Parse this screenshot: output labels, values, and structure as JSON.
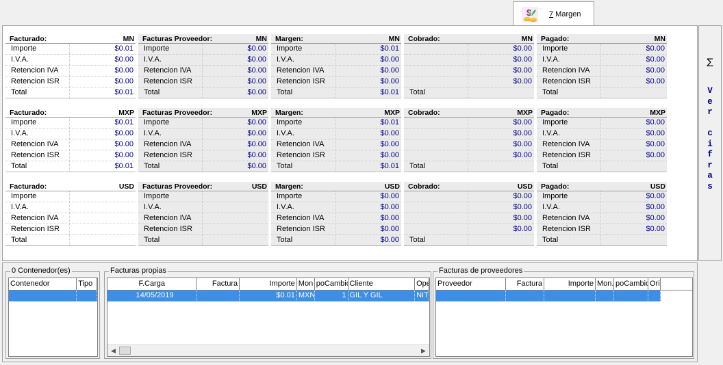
{
  "tab": {
    "label_key": "7",
    "label_rest": " Margen",
    "icon": "money-plant-icon"
  },
  "side": {
    "sigma": "Σ",
    "ver_cifras": "Ver\ncifras"
  },
  "accent": "#00008b",
  "summary": {
    "rows_labels": [
      "Importe",
      "I.V.A.",
      "Retencion IVA",
      "Retencion ISR",
      "Total"
    ],
    "sections": [
      {
        "currency": "MN",
        "cards": [
          {
            "title": "Facturado:",
            "values": [
              "$0.01",
              "$0.00",
              "$0.00",
              "$0.00",
              "$0.01"
            ]
          },
          {
            "title": "Facturas Proveedor:",
            "values": [
              "$0.00",
              "$0.00",
              "$0.00",
              "$0.00",
              "$0.00"
            ]
          },
          {
            "title": "Margen:",
            "values": [
              "$0.01",
              "$0.00",
              "$0.00",
              "$0.00",
              "$0.01"
            ]
          },
          {
            "title": "Cobrado:",
            "labels": [
              "",
              "",
              "",
              "",
              "Total"
            ],
            "values": [
              "$0.00",
              "$0.00",
              "$0.00",
              "$0.00",
              ""
            ]
          },
          {
            "title": "Pagado:",
            "values": [
              "$0.00",
              "$0.00",
              "$0.00",
              "$0.00",
              ""
            ]
          }
        ]
      },
      {
        "currency": "MXP",
        "cards": [
          {
            "title": "Facturado:",
            "values": [
              "$0.01",
              "$0.00",
              "$0.00",
              "$0.00",
              "$0.01"
            ]
          },
          {
            "title": "Facturas Proveedor:",
            "values": [
              "$0.00",
              "$0.00",
              "$0.00",
              "$0.00",
              "$0.00"
            ]
          },
          {
            "title": "Margen:",
            "values": [
              "$0.01",
              "$0.00",
              "$0.00",
              "$0.00",
              "$0.01"
            ]
          },
          {
            "title": "Cobrado:",
            "labels": [
              "",
              "",
              "",
              "",
              "Total"
            ],
            "values": [
              "$0.00",
              "$0.00",
              "$0.00",
              "$0.00",
              ""
            ]
          },
          {
            "title": "Pagado:",
            "values": [
              "$0.00",
              "$0.00",
              "$0.00",
              "$0.00",
              ""
            ]
          }
        ]
      },
      {
        "currency": "USD",
        "cards": [
          {
            "title": "Facturado:",
            "values": [
              "",
              "",
              "",
              "",
              ""
            ]
          },
          {
            "title": "Facturas Proveedor:",
            "values": [
              "",
              "",
              "",
              "",
              ""
            ]
          },
          {
            "title": "Margen:",
            "values": [
              "$0.00",
              "$0.00",
              "$0.00",
              "$0.00",
              "$0.00"
            ]
          },
          {
            "title": "Cobrado:",
            "labels": [
              "",
              "",
              "",
              "",
              "Total"
            ],
            "values": [
              "$0.00",
              "$0.00",
              "$0.00",
              "$0.00",
              ""
            ]
          },
          {
            "title": "Pagado:",
            "values": [
              "$0.00",
              "$0.00",
              "$0.00",
              "$0.00",
              ""
            ]
          }
        ]
      }
    ]
  },
  "contenedores": {
    "title": "0 Contenedor(es)",
    "columns": [
      "Contenedor",
      "Tipo"
    ],
    "rows": [
      [
        "",
        ""
      ]
    ]
  },
  "facturas_propias": {
    "title": "Facturas propias",
    "columns": [
      "F.Carga",
      "Factura",
      "Importe",
      "Mon",
      "poCambio",
      "Cliente",
      "Ope"
    ],
    "rows": [
      [
        "14/05/2019",
        "",
        "$0.01",
        "MXN",
        "1",
        "GIL Y GIL",
        "NIT"
      ]
    ]
  },
  "facturas_proveedores": {
    "title": "Facturas de proveedores",
    "columns": [
      "Proveedor",
      "Factura",
      "Importe",
      "Mon.",
      "poCambio",
      "Ori"
    ],
    "rows": [
      [
        "",
        "",
        "",
        "",
        "",
        ""
      ]
    ]
  }
}
